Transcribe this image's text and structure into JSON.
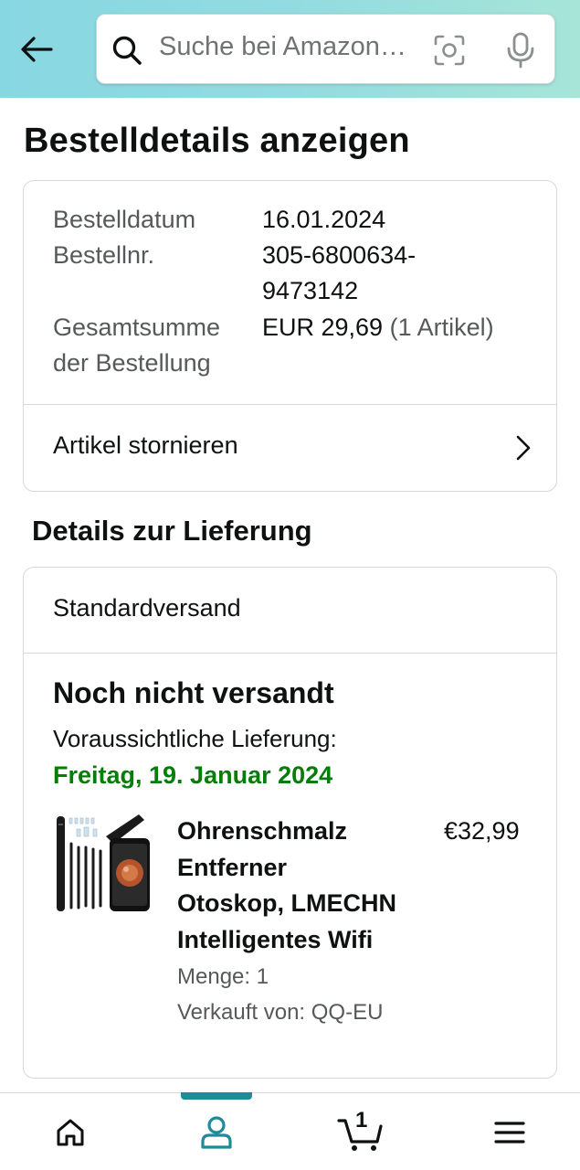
{
  "header": {
    "search_placeholder": "Suche bei Amazon.de",
    "colors": {
      "gradient_start": "#87d7e2",
      "gradient_end": "#a6e5d8"
    }
  },
  "page_title": "Bestelldetails anzeigen",
  "order_summary": {
    "rows": [
      {
        "label": "Bestelldatum",
        "value": "16.01.2024"
      },
      {
        "label": "Bestellnr.",
        "value_line1": "305-6800634-",
        "value_line2": "9473142"
      },
      {
        "label_line1": "Gesamtsumme",
        "label_line2": "der Bestellung",
        "value": "EUR 29,69",
        "value_suffix": "(1 Artikel)"
      }
    ],
    "cancel_label": "Artikel stornieren"
  },
  "delivery": {
    "section_title": "Details zur Lieferung",
    "shipping_type": "Standardversand",
    "status": "Noch nicht versandt",
    "expected_label": "Voraussichtliche Lieferung:",
    "expected_date": "Freitag, 19. Januar 2024",
    "date_color": "#067d0a",
    "item": {
      "title_lines": [
        "Ohrenschmalz",
        "Entferner",
        "Otoskop, LMECHN",
        "Intelligentes Wifi"
      ],
      "price": "€32,99",
      "quantity": "Menge: 1",
      "seller": "Verkauft von: QQ-EU",
      "image_icon": "product-otoscope-image"
    }
  },
  "bottom_nav": {
    "items": [
      "home-icon",
      "account-icon",
      "cart-icon",
      "menu-icon"
    ],
    "active": "account-icon",
    "cart_count": "1",
    "accent_color": "#1f8a99"
  }
}
